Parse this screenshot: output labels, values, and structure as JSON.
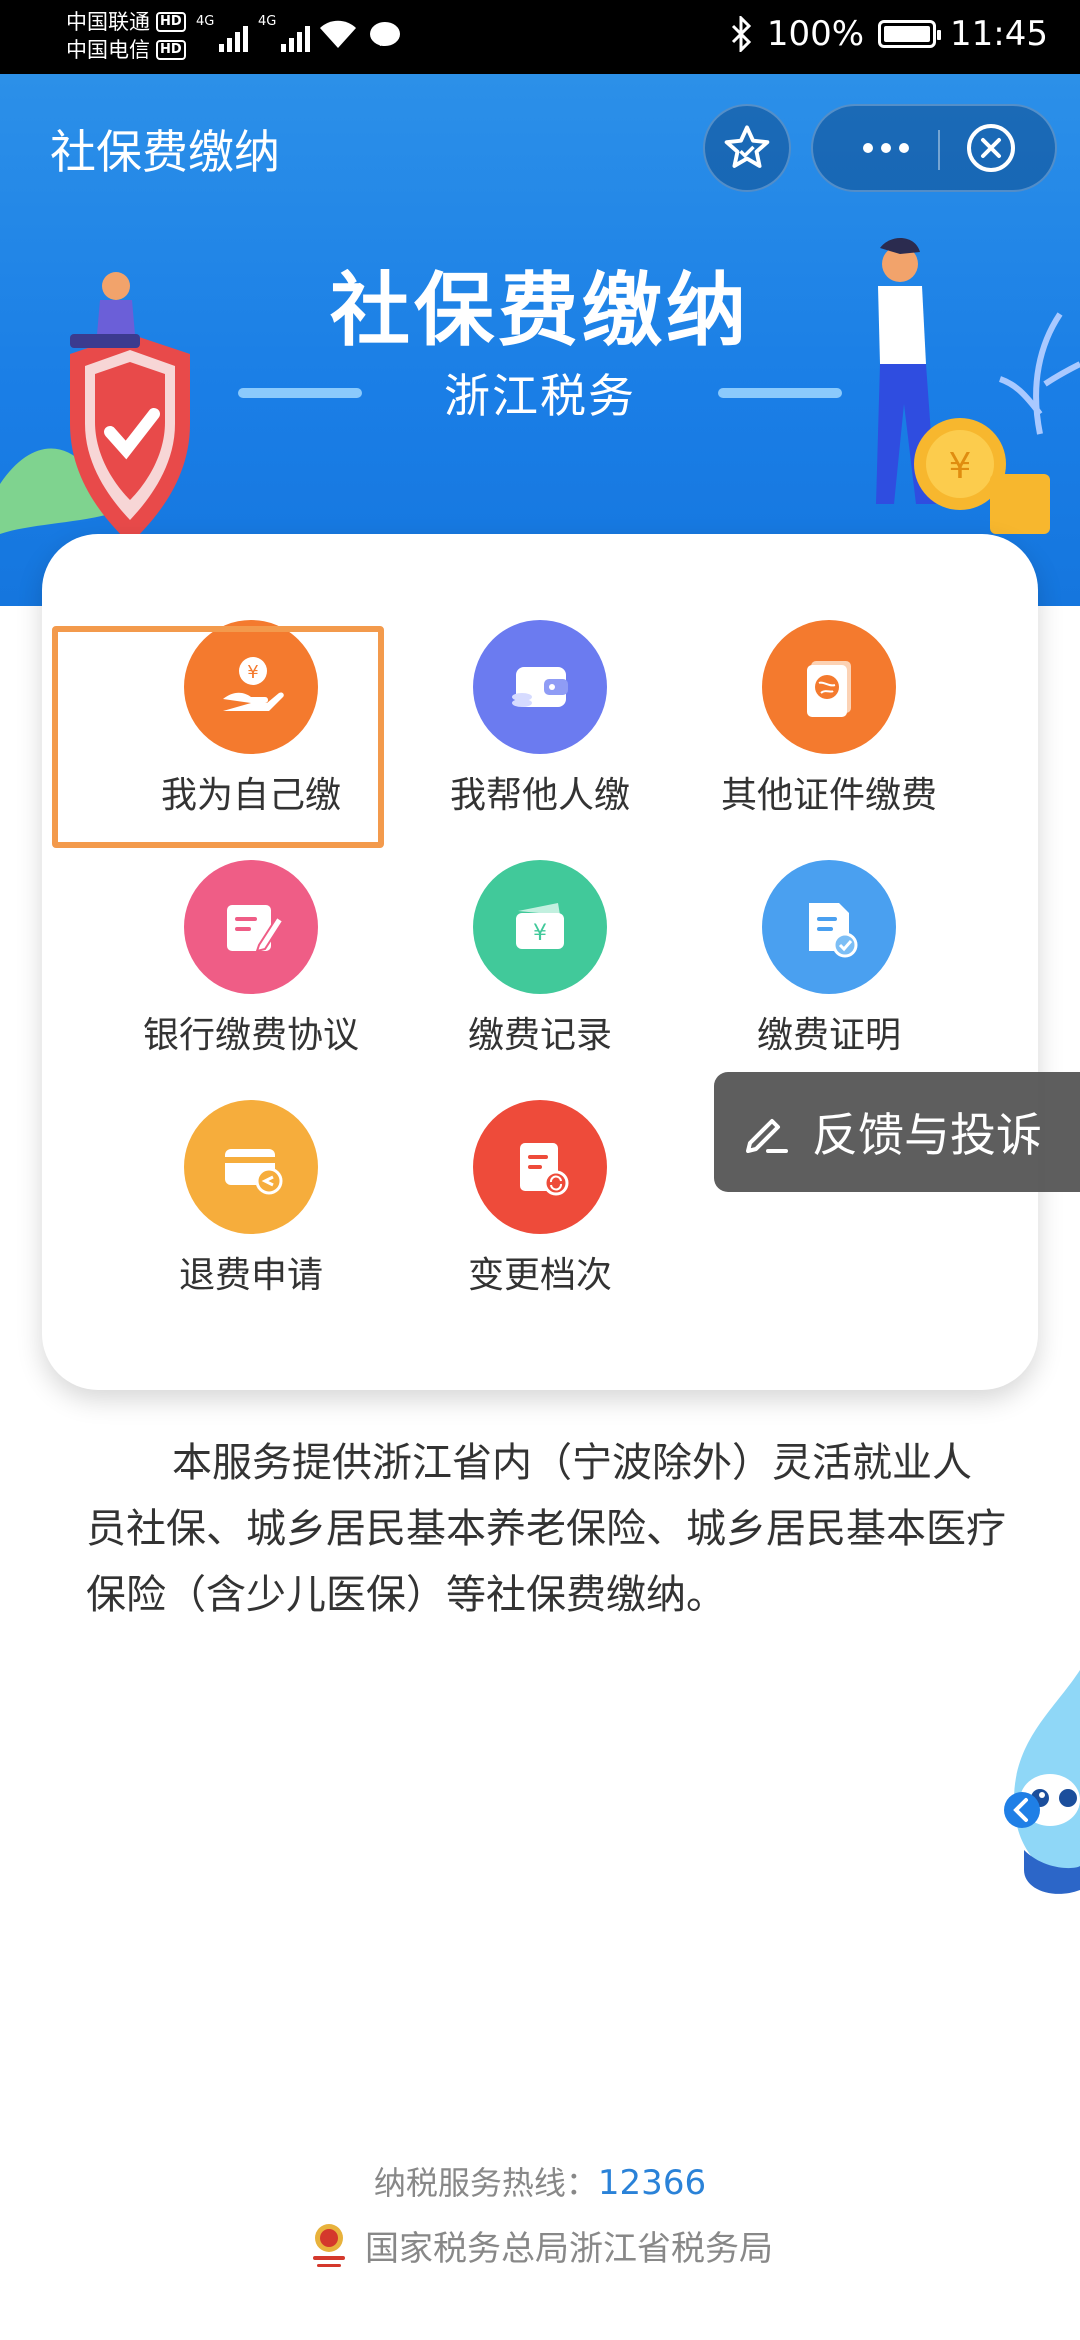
{
  "status_bar": {
    "carrier1": "中国联通",
    "carrier2": "中国电信",
    "hd": "HD",
    "network": "4G",
    "battery": "100%",
    "time": "11:45"
  },
  "header": {
    "title": "社保费缴纳"
  },
  "banner": {
    "title": "社保费缴纳",
    "subtitle": "浙江税务"
  },
  "menu": {
    "items": [
      {
        "label": "我为自己缴",
        "icon": "hand-yuan-icon",
        "color": "#f47a2e"
      },
      {
        "label": "我帮他人缴",
        "icon": "wallet-icon",
        "color": "#6b7bf0"
      },
      {
        "label": "其他证件缴费",
        "icon": "passport-icon",
        "color": "#f47a2e"
      },
      {
        "label": "银行缴费协议",
        "icon": "agreement-icon",
        "color": "#ef5d86"
      },
      {
        "label": "缴费记录",
        "icon": "yuan-card-icon",
        "color": "#41c99a"
      },
      {
        "label": "缴费证明",
        "icon": "certificate-icon",
        "color": "#4aa0f0"
      },
      {
        "label": "退费申请",
        "icon": "refund-card-icon",
        "color": "#f6ad3c"
      },
      {
        "label": "变更档次",
        "icon": "change-doc-icon",
        "color": "#ee4b3a"
      }
    ]
  },
  "feedback": {
    "label": "反馈与投诉"
  },
  "description": "本服务提供浙江省内（宁波除外）灵活就业人员社保、城乡居民基本养老保险、城乡居民基本医疗保险（含少儿医保）等社保费缴纳。",
  "footer": {
    "hotline_label": "纳税服务热线：",
    "hotline_number": "12366",
    "org": "国家税务总局浙江省税务局"
  }
}
